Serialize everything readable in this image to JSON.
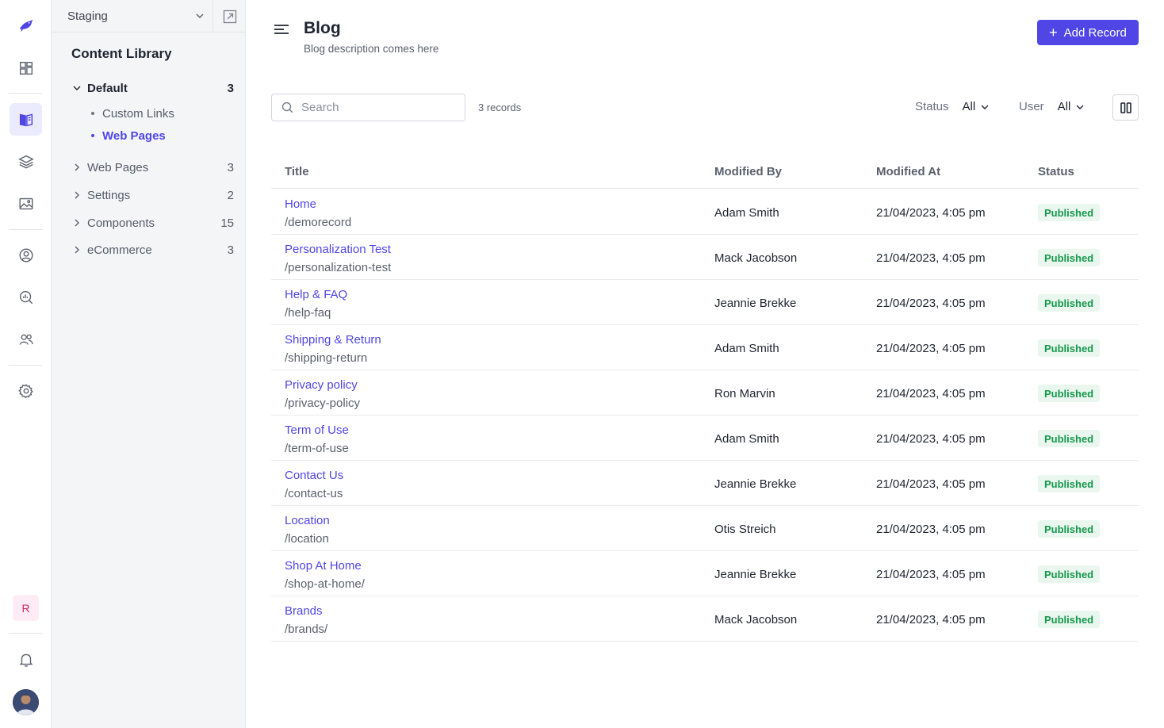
{
  "environment": {
    "label": "Staging"
  },
  "sidebar": {
    "title": "Content Library",
    "default_group": {
      "label": "Default",
      "count": "3",
      "children": [
        {
          "label": "Custom Links",
          "active": false
        },
        {
          "label": "Web Pages",
          "active": true
        }
      ]
    },
    "groups": [
      {
        "label": "Web Pages",
        "count": "3"
      },
      {
        "label": "Settings",
        "count": "2"
      },
      {
        "label": "Components",
        "count": "15"
      },
      {
        "label": "eCommerce",
        "count": "3"
      }
    ]
  },
  "rail": {
    "icons": [
      "logo-bird-icon",
      "dashboard-icon",
      "content-library-icon",
      "layers-icon",
      "media-icon",
      "user-circle-icon",
      "analytics-icon",
      "team-icon",
      "settings-gear-icon",
      "bell-icon"
    ],
    "workspace_initial": "R"
  },
  "header": {
    "title": "Blog",
    "description": "Blog description comes here",
    "add_button": "Add Record"
  },
  "toolbar": {
    "search_placeholder": "Search",
    "records_count": "3 records",
    "status_label": "Status",
    "status_value": "All",
    "user_label": "User",
    "user_value": "All"
  },
  "table": {
    "columns": [
      "Title",
      "Modified By",
      "Modified At",
      "Status"
    ],
    "rows": [
      {
        "title": "Home",
        "slug": "/demorecord",
        "modified_by": "Adam Smith",
        "modified_at": "21/04/2023, 4:05 pm",
        "status": "Published"
      },
      {
        "title": "Personalization Test",
        "slug": "/personalization-test",
        "modified_by": "Mack Jacobson",
        "modified_at": "21/04/2023, 4:05 pm",
        "status": "Published"
      },
      {
        "title": "Help & FAQ",
        "slug": "/help-faq",
        "modified_by": "Jeannie Brekke",
        "modified_at": "21/04/2023, 4:05 pm",
        "status": "Published"
      },
      {
        "title": "Shipping & Return",
        "slug": "/shipping-return",
        "modified_by": "Adam Smith",
        "modified_at": "21/04/2023, 4:05 pm",
        "status": "Published"
      },
      {
        "title": "Privacy policy",
        "slug": "/privacy-policy",
        "modified_by": "Ron Marvin",
        "modified_at": "21/04/2023, 4:05 pm",
        "status": "Published"
      },
      {
        "title": "Term of Use",
        "slug": "/term-of-use",
        "modified_by": "Adam Smith",
        "modified_at": "21/04/2023, 4:05 pm",
        "status": "Published"
      },
      {
        "title": "Contact Us",
        "slug": "/contact-us",
        "modified_by": "Jeannie Brekke",
        "modified_at": "21/04/2023, 4:05 pm",
        "status": "Published"
      },
      {
        "title": "Location",
        "slug": "/location",
        "modified_by": "Otis Streich",
        "modified_at": "21/04/2023, 4:05 pm",
        "status": "Published"
      },
      {
        "title": "Shop At Home",
        "slug": "/shop-at-home/",
        "modified_by": "Jeannie Brekke",
        "modified_at": "21/04/2023, 4:05 pm",
        "status": "Published"
      },
      {
        "title": "Brands",
        "slug": "/brands/",
        "modified_by": "Mack Jacobson",
        "modified_at": "21/04/2023, 4:05 pm",
        "status": "Published"
      }
    ]
  },
  "colors": {
    "accent": "#4f46e5",
    "status_published_bg": "#e9f7ef",
    "status_published_text": "#17984d"
  }
}
